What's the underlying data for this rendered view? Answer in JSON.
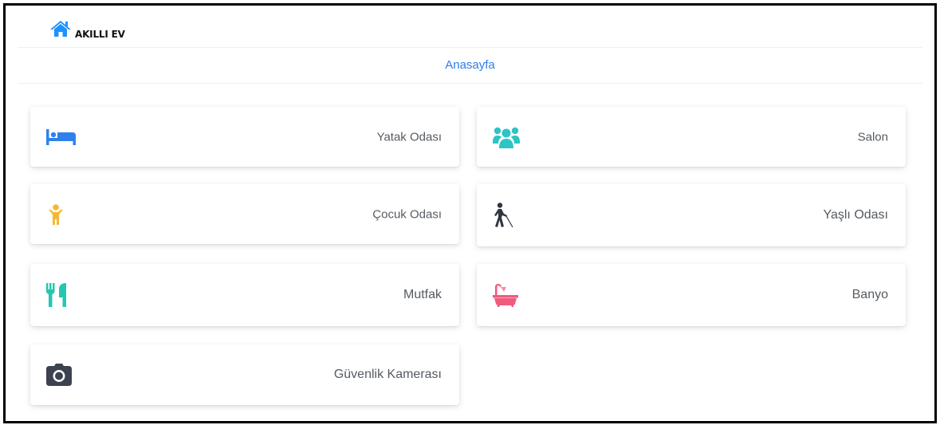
{
  "header": {
    "brand": "AKILLI EV",
    "nav_home": "Anasayfa"
  },
  "rooms": [
    {
      "label": "Yatak Odası",
      "icon": "bed-icon",
      "color": "#2f80ed"
    },
    {
      "label": "Salon",
      "icon": "users-icon",
      "color": "#2ec4c4"
    },
    {
      "label": "Çocuk Odası",
      "icon": "child-icon",
      "color": "#f7b733"
    },
    {
      "label": "Yaşlı Odası",
      "icon": "blind-walker-icon",
      "color": "#2f3640"
    },
    {
      "label": "Mutfak",
      "icon": "utensils-icon",
      "color": "#25c7b0"
    },
    {
      "label": "Banyo",
      "icon": "bath-icon",
      "color": "#ef5b7c"
    },
    {
      "label": "Güvenlik Kamerası",
      "icon": "camera-icon",
      "color": "#3c4250"
    }
  ],
  "colors": {
    "brand_icon": "#1e90ff",
    "nav_link": "#2b7de9"
  }
}
